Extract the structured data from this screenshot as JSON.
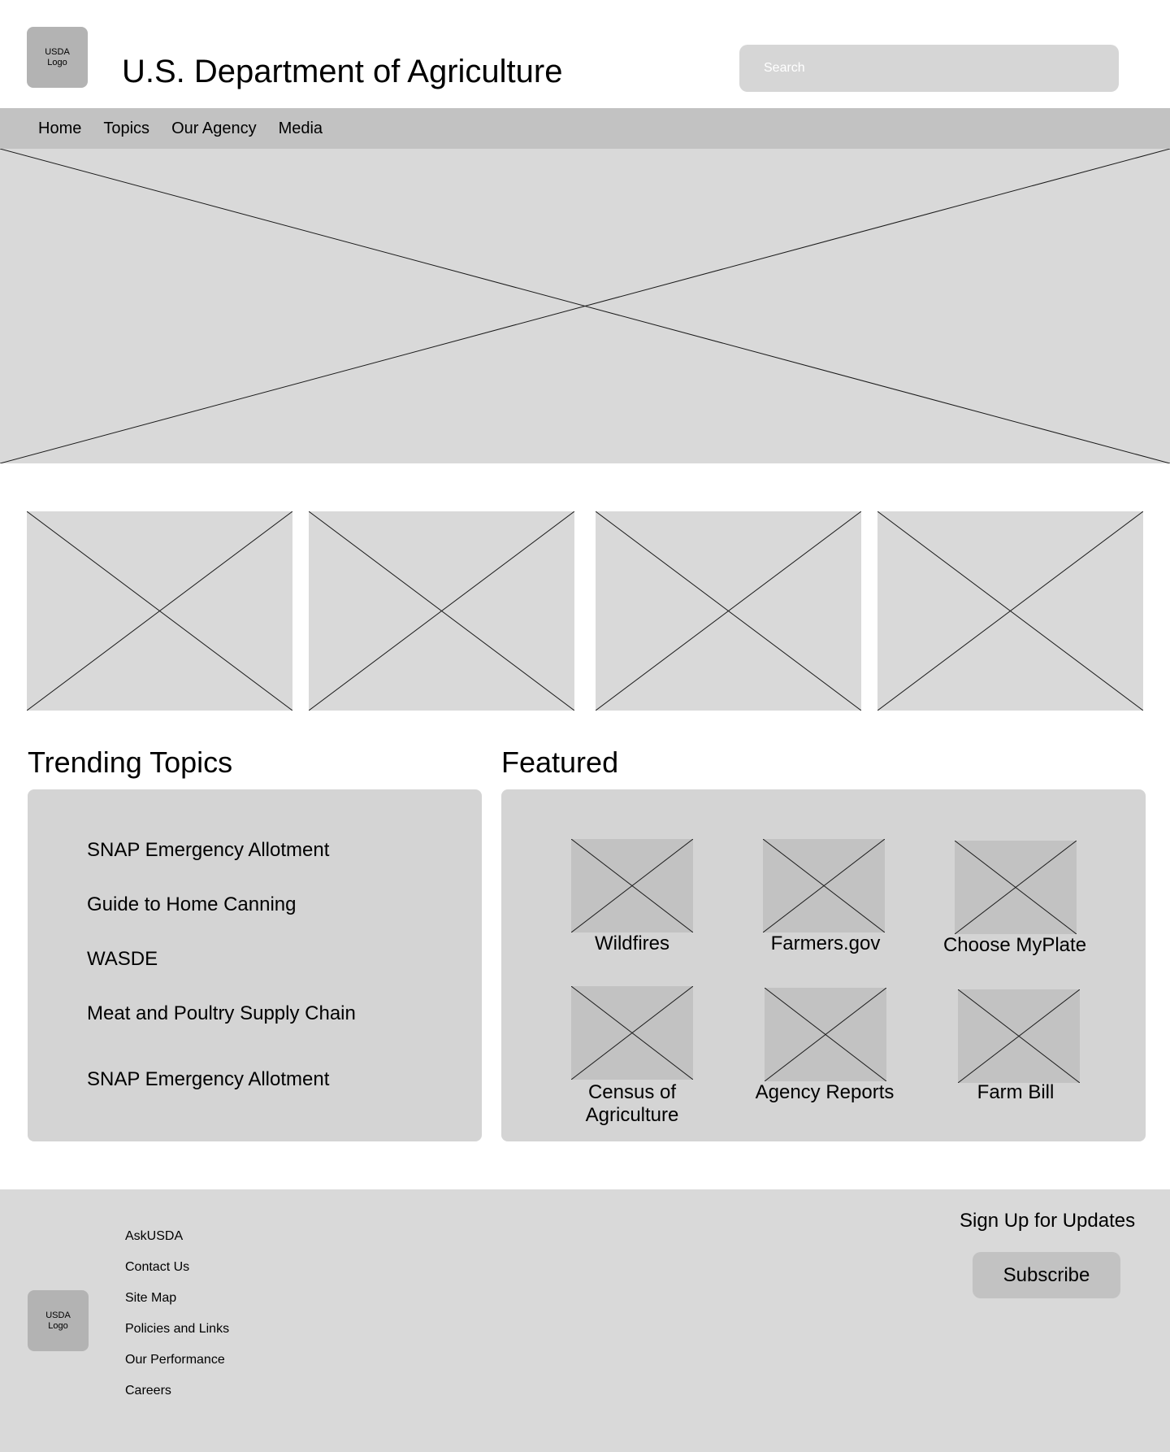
{
  "header": {
    "logo_text": "USDA Logo",
    "title": "U.S. Department of Agriculture",
    "search_placeholder": "Search"
  },
  "nav": {
    "items": [
      "Home",
      "Topics",
      "Our Agency",
      "Media"
    ]
  },
  "trending": {
    "heading": "Trending Topics",
    "items": [
      "SNAP Emergency Allotment",
      "Guide to Home Canning",
      "WASDE",
      "Meat and Poultry Supply Chain",
      "SNAP Emergency Allotment"
    ]
  },
  "featured": {
    "heading": "Featured",
    "items": [
      "Wildfires",
      "Farmers.gov",
      "Choose MyPlate",
      "Census of Agriculture",
      "Agency Reports",
      "Farm Bill"
    ]
  },
  "footer": {
    "logo_text": "USDA Logo",
    "links": [
      "AskUSDA",
      "Contact Us",
      "Site Map",
      "Policies and Links",
      "Our Performance",
      "Careers"
    ],
    "signup_label": "Sign Up for Updates",
    "subscribe_label": "Subscribe"
  },
  "colors": {
    "placeholder_fill": "#d9d9d9",
    "nav_bg": "#c2c2c2",
    "panel_bg": "#d4d4d4",
    "logo_bg": "#b3b3b3"
  }
}
